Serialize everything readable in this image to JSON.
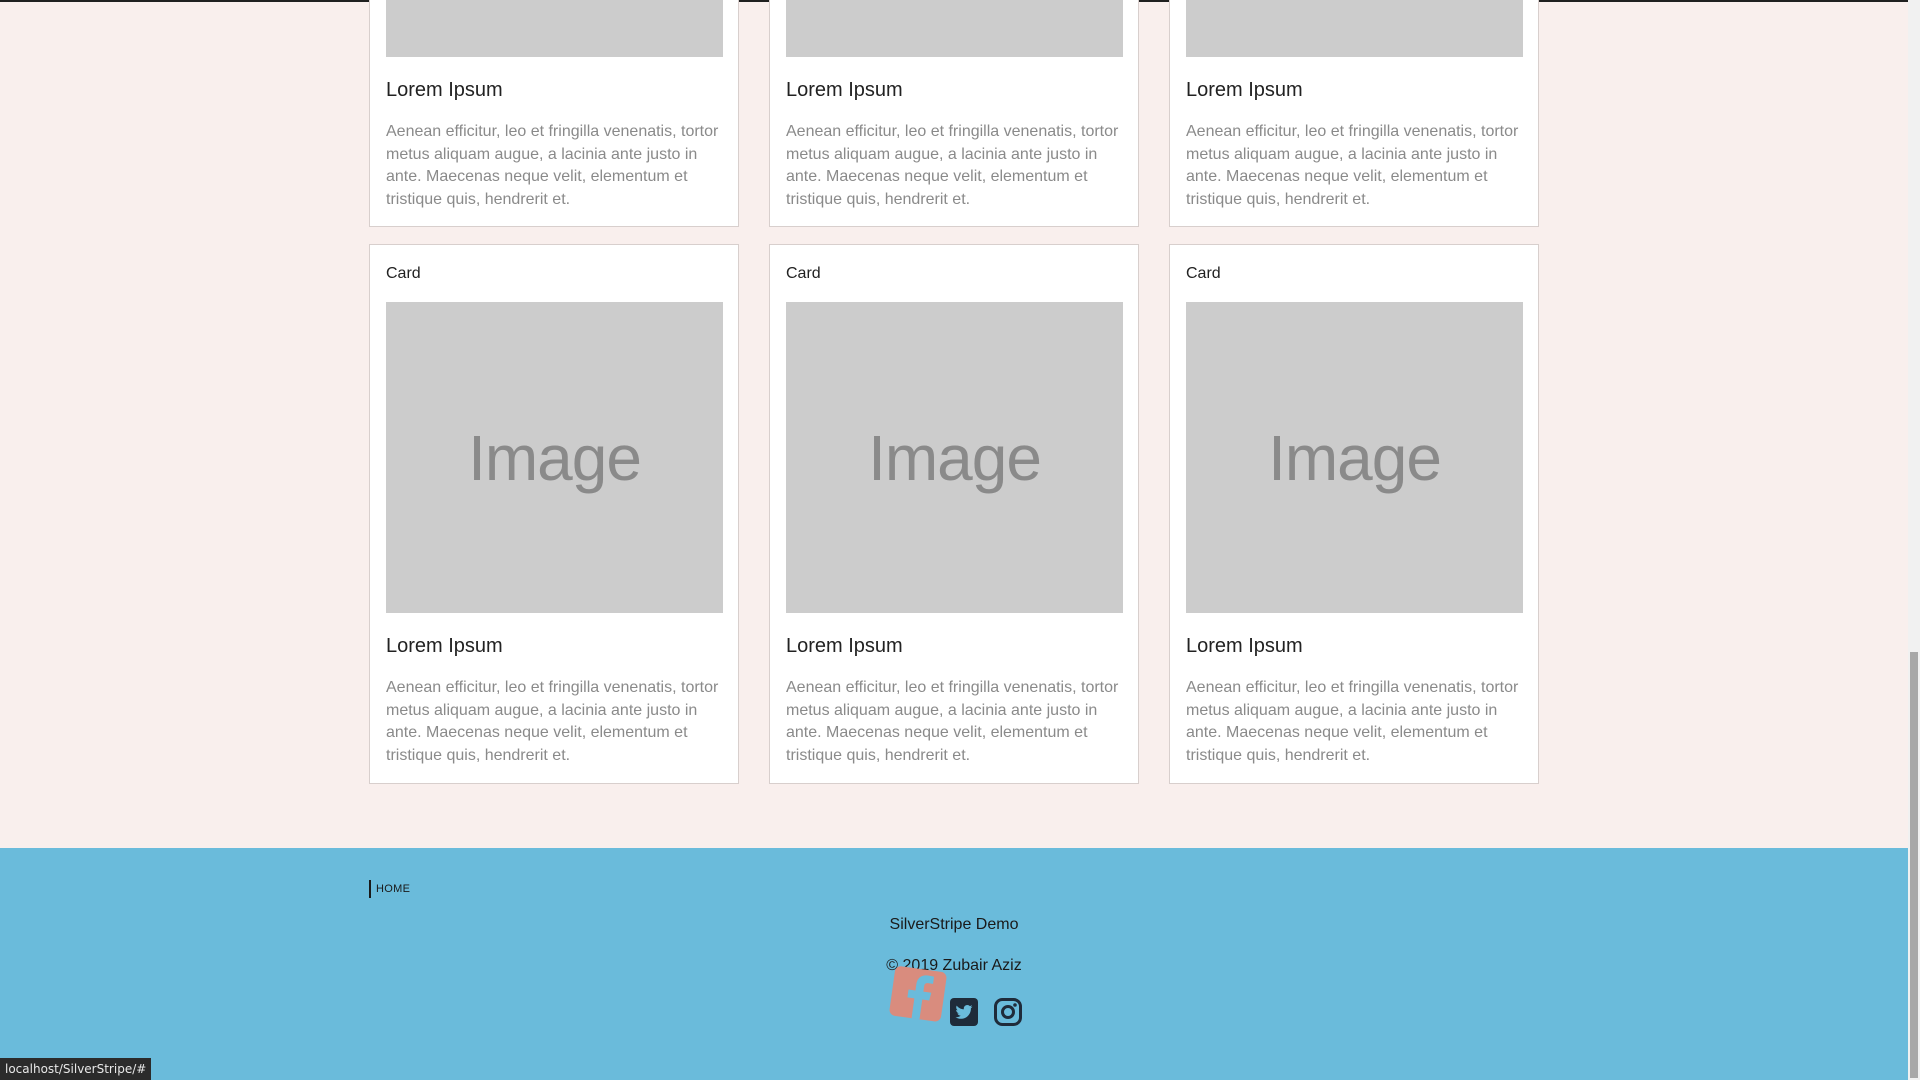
{
  "cards_row1": [
    {
      "title": "Lorem Ipsum",
      "text": "Aenean efficitur, leo et fringilla venenatis, tortor metus aliquam augue, a lacinia ante justo in ante. Maecenas neque velit, elementum et tristique quis, hendrerit et."
    },
    {
      "title": "Lorem Ipsum",
      "text": "Aenean efficitur, leo et fringilla venenatis, tortor metus aliquam augue, a lacinia ante justo in ante. Maecenas neque velit, elementum et tristique quis, hendrerit et."
    },
    {
      "title": "Lorem Ipsum",
      "text": "Aenean efficitur, leo et fringilla venenatis, tortor metus aliquam augue, a lacinia ante justo in ante. Maecenas neque velit, elementum et tristique quis, hendrerit et."
    }
  ],
  "cards_row2": [
    {
      "label": "Card",
      "image_text": "Image",
      "title": "Lorem Ipsum",
      "text": "Aenean efficitur, leo et fringilla venenatis, tortor metus aliquam augue, a lacinia ante justo in ante. Maecenas neque velit, elementum et tristique quis, hendrerit et."
    },
    {
      "label": "Card",
      "image_text": "Image",
      "title": "Lorem Ipsum",
      "text": "Aenean efficitur, leo et fringilla venenatis, tortor metus aliquam augue, a lacinia ante justo in ante. Maecenas neque velit, elementum et tristique quis, hendrerit et."
    },
    {
      "label": "Card",
      "image_text": "Image",
      "title": "Lorem Ipsum",
      "text": "Aenean efficitur, leo et fringilla venenatis, tortor metus aliquam augue, a lacinia ante justo in ante. Maecenas neque velit, elementum et tristique quis, hendrerit et."
    }
  ],
  "footer": {
    "nav": [
      {
        "label": "HOME"
      }
    ],
    "site_name": "SilverStripe Demo",
    "copyright": "© 2019 Zubair Aziz",
    "social": [
      "facebook-icon",
      "twitter-icon",
      "instagram-icon"
    ]
  },
  "status_bar": {
    "url": "localhost/SilverStripe/#"
  },
  "colors": {
    "page_bg": "#f9efed",
    "footer_bg": "#6abbdb",
    "image_placeholder": "#cccccc",
    "facebook_overlay": "#d98c7e",
    "icon_dark": "#1f2b3a"
  }
}
